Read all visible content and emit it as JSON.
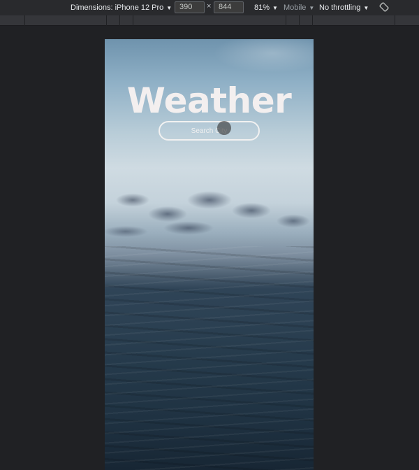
{
  "devtools": {
    "dimensions_label": "Dimensions: iPhone 12 Pro",
    "width_value": "390",
    "times_symbol": "×",
    "height_value": "844",
    "zoom": "81%",
    "device_type": "Mobile",
    "throttling": "No throttling",
    "rotate_icon": "rotate-icon"
  },
  "app": {
    "title": "Weather",
    "search_placeholder": "Search City"
  }
}
